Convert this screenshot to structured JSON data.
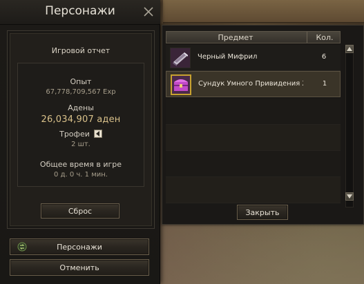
{
  "window": {
    "title": "Персонажи"
  },
  "report": {
    "title": "Игровой отчет",
    "exp_label": "Опыт",
    "exp_value": "67,778,709,567 Exp",
    "adena_label": "Адены",
    "adena_value": "26,034,907 аден",
    "trophies_label": "Трофеи",
    "trophies_value": "2 шт.",
    "playtime_label": "Общее время в игре",
    "playtime_value": "0 д. 0 ч. 1 мин.",
    "reset_label": "Сброс"
  },
  "buttons": {
    "characters_label": "Персонажи",
    "cancel_label": "Отменить"
  },
  "loot": {
    "col_item": "Предмет",
    "col_qty": "Кол.",
    "rows": [
      {
        "name": "Черный Мифрил",
        "qty": "6",
        "icon": "black-mithril-icon",
        "selected": false
      },
      {
        "name": "Сундук Умного Привидения Х:",
        "qty": "1",
        "icon": "smart-ghost-chest-icon",
        "selected": true
      }
    ],
    "close_label": "Закрыть"
  },
  "colors": {
    "accent_gold": "#d9c18a",
    "selected_border": "#c8a230",
    "panel_bg": "#1c1a17"
  }
}
